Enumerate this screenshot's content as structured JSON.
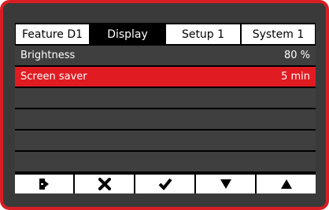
{
  "tabs": [
    {
      "label": "Feature  D1",
      "active": false
    },
    {
      "label": "Display",
      "active": true
    },
    {
      "label": "Setup 1",
      "active": false
    },
    {
      "label": "System 1",
      "active": false
    }
  ],
  "rows": [
    {
      "label": "Brightness",
      "value": "80 %",
      "selected": false
    },
    {
      "label": "Screen saver",
      "value": "5 min",
      "selected": true
    },
    {
      "label": "",
      "value": "",
      "selected": false
    },
    {
      "label": "",
      "value": "",
      "selected": false
    },
    {
      "label": "",
      "value": "",
      "selected": false
    },
    {
      "label": "",
      "value": "",
      "selected": false
    }
  ],
  "softkeys": [
    {
      "icon": "exit-icon"
    },
    {
      "icon": "cancel-x-icon"
    },
    {
      "icon": "confirm-check-icon"
    },
    {
      "icon": "arrow-down-icon"
    },
    {
      "icon": "arrow-up-icon"
    }
  ],
  "colors": {
    "frame": "#d81e24",
    "highlight": "#e11b22",
    "row": "#3f3f3f",
    "screen": "#000000"
  }
}
